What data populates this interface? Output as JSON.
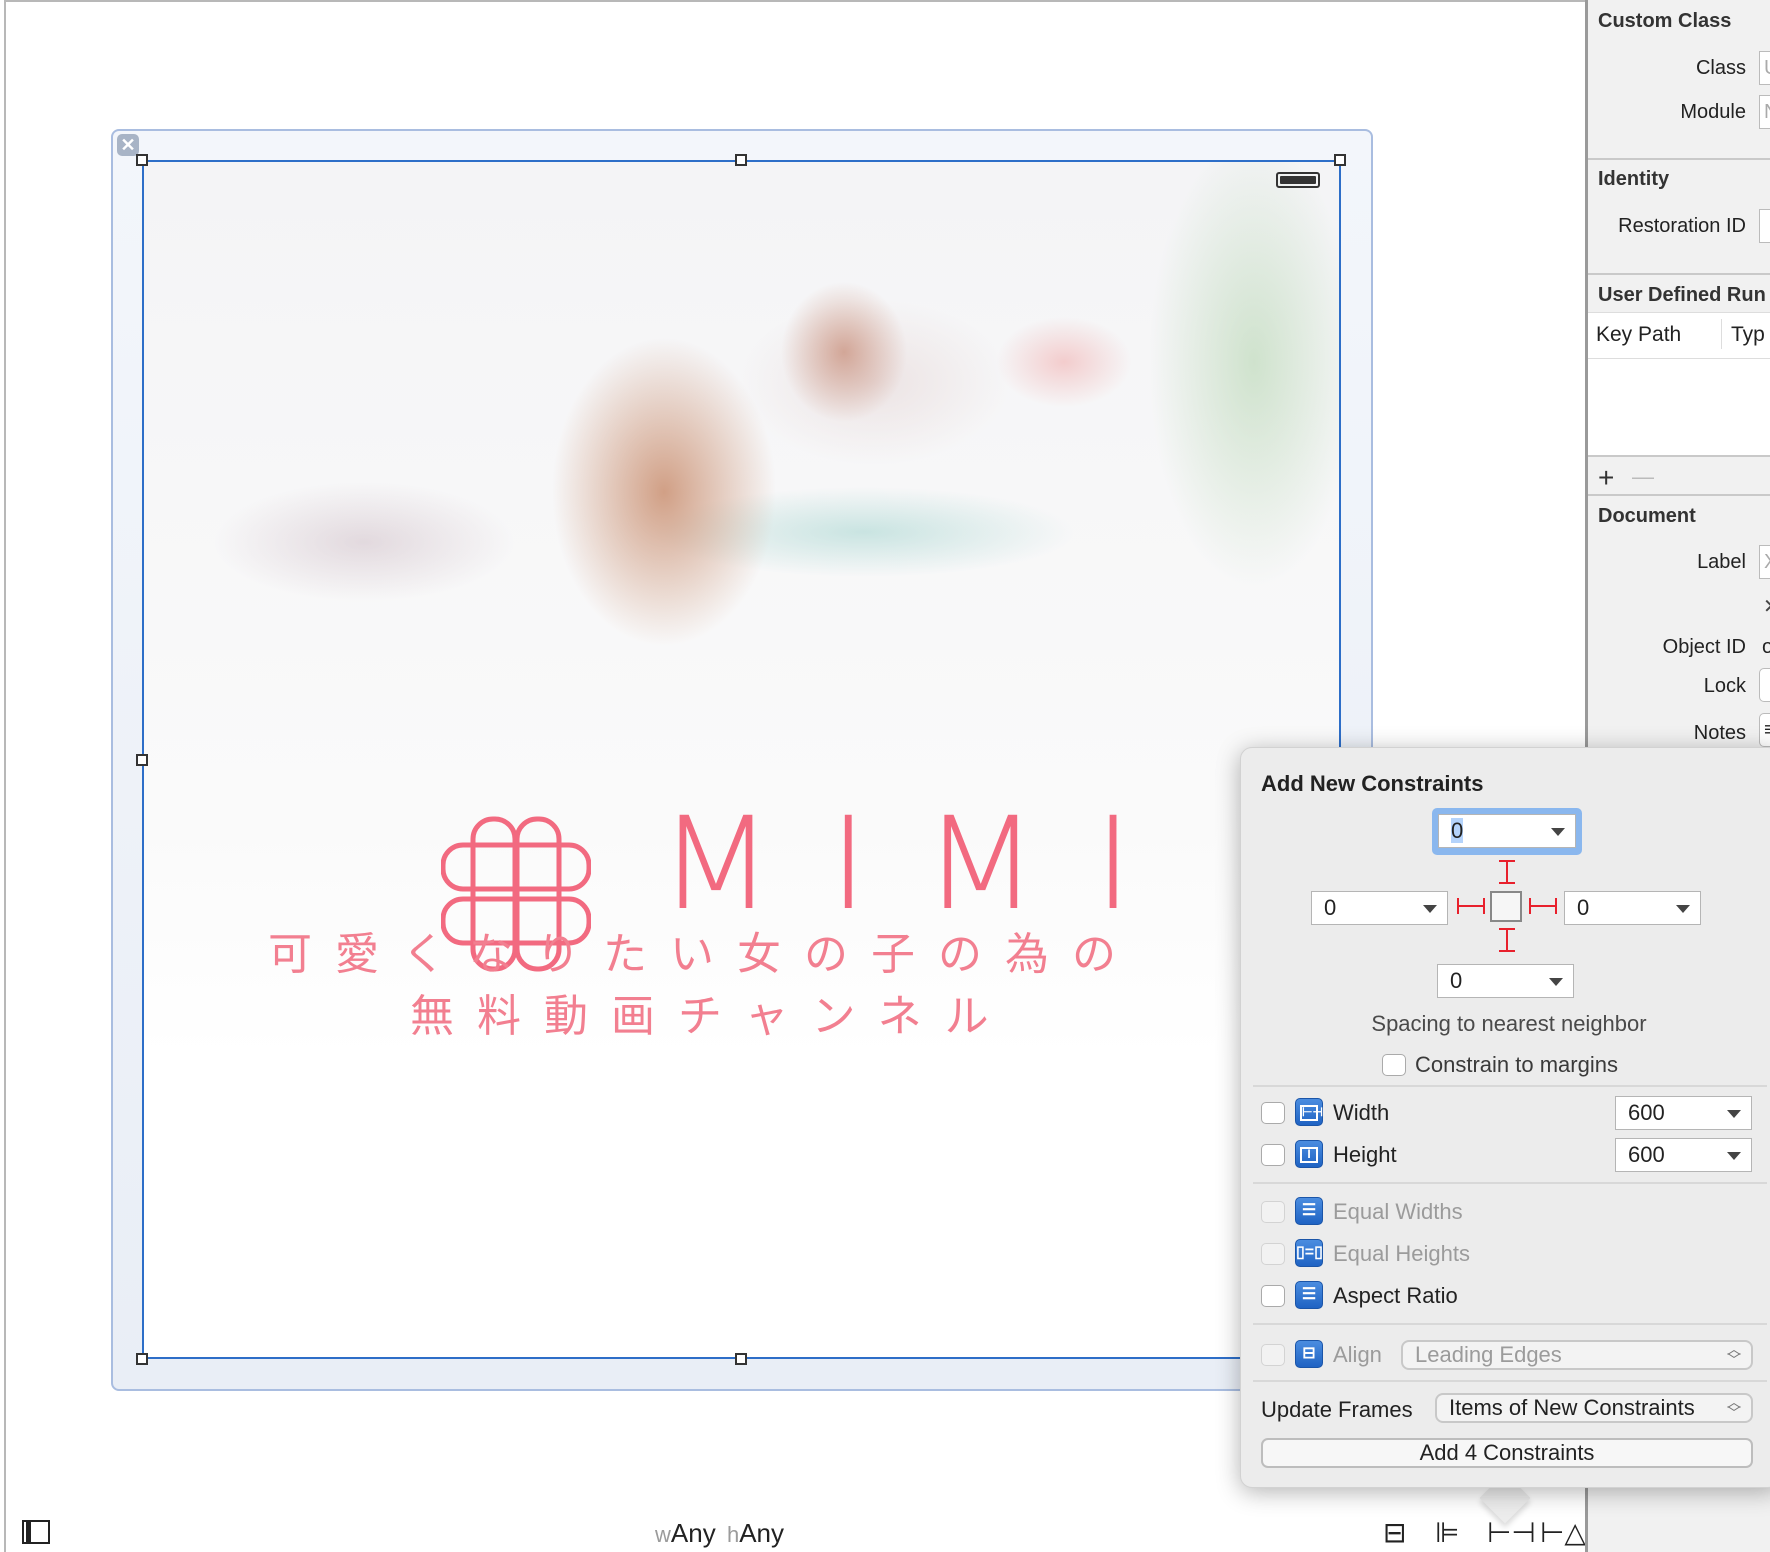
{
  "canvas": {
    "size_class": {
      "w_prefix": "w",
      "w_value": "Any",
      "h_prefix": "h",
      "h_value": "Any"
    },
    "image": {
      "logo_text": "MIMI",
      "tagline_line1": "可愛くなりたい女の子の為の",
      "tagline_line2": "無料動画チャンネル",
      "brand_color": "#f26a80"
    },
    "bottom_icons": [
      "embed-in-stack-icon",
      "align-icon",
      "pin-icon",
      "resolve-auto-layout-icon"
    ]
  },
  "inspector": {
    "custom_class": {
      "title": "Custom Class",
      "class_label": "Class",
      "class_placeholder": "U",
      "module_label": "Module",
      "module_placeholder": "N"
    },
    "identity": {
      "title": "Identity",
      "restoration_id_label": "Restoration ID"
    },
    "user_defined": {
      "title": "User Defined Run",
      "col_key_path": "Key Path",
      "col_type": "Typ",
      "add": "+",
      "remove": "—"
    },
    "document": {
      "title": "Document",
      "label_label": "Label",
      "label_placeholder": "X",
      "clear": "✕",
      "object_id_label": "Object ID",
      "object_id_value": "o",
      "lock_label": "Lock",
      "notes_label": "Notes",
      "notes_icon": "≡"
    }
  },
  "popover": {
    "title": "Add New Constraints",
    "top": "0",
    "left": "0",
    "right": "0",
    "bottom": "0",
    "spacing_label": "Spacing to nearest neighbor",
    "constrain_margins": "Constrain to margins",
    "width_label": "Width",
    "width_value": "600",
    "height_label": "Height",
    "height_value": "600",
    "equal_widths": "Equal Widths",
    "equal_heights": "Equal Heights",
    "aspect_ratio": "Aspect Ratio",
    "align_label": "Align",
    "align_value": "Leading Edges",
    "update_frames_label": "Update Frames",
    "update_frames_value": "Items of New Constraints",
    "add_button": "Add 4 Constraints",
    "accent_color": "#2d6ec8",
    "constraint_color": "#e8202c"
  }
}
